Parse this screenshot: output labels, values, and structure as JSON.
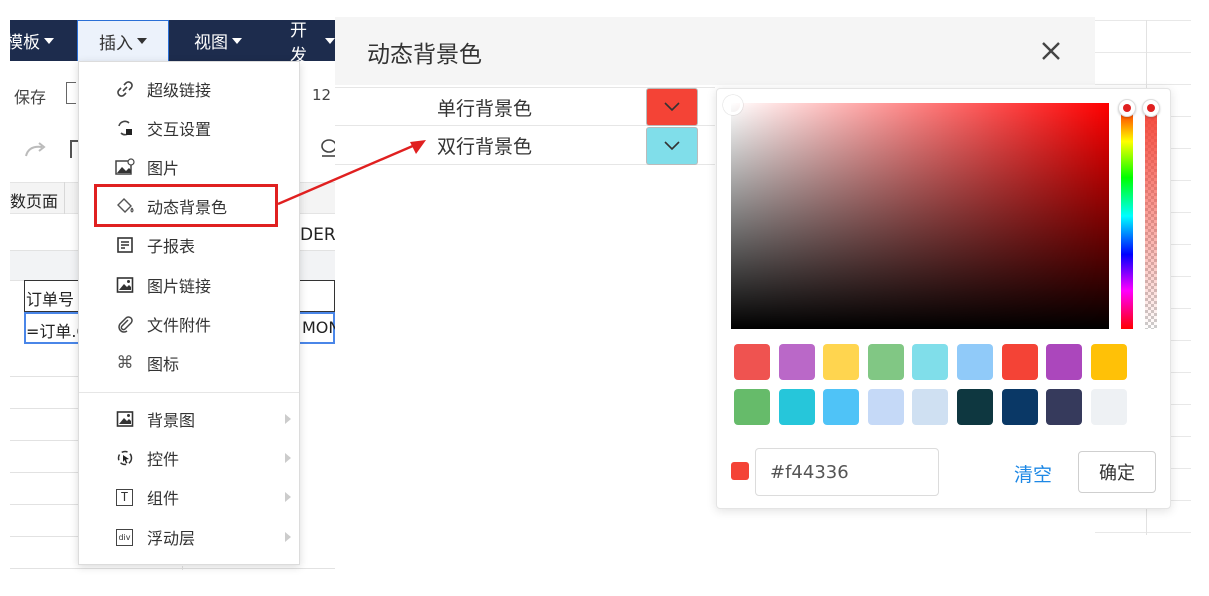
{
  "menubar": {
    "items": [
      {
        "label": "模板"
      },
      {
        "label": "插入"
      },
      {
        "label": "视图"
      },
      {
        "label": "开发"
      }
    ]
  },
  "toolbar": {
    "save_label": "保存",
    "font_size": "12"
  },
  "sheet": {
    "tab_label": "数页面",
    "partial_text_der": "DER",
    "cell_order_no": "订单号",
    "cell_formula": "=订单.C",
    "cell_mon": "MON"
  },
  "insert_menu": {
    "items": [
      {
        "label": "超级链接",
        "icon": "hyperlink-icon"
      },
      {
        "label": "交互设置",
        "icon": "interaction-icon"
      },
      {
        "label": "图片",
        "icon": "image-icon"
      },
      {
        "label": "动态背景色",
        "icon": "paint-bucket-icon"
      },
      {
        "label": "子报表",
        "icon": "subreport-icon"
      },
      {
        "label": "图片链接",
        "icon": "image-link-icon"
      },
      {
        "label": "文件附件",
        "icon": "paperclip-icon"
      },
      {
        "label": "图标",
        "icon": "command-icon"
      },
      {
        "label": "背景图",
        "icon": "background-image-icon",
        "submenu": true
      },
      {
        "label": "控件",
        "icon": "control-icon",
        "submenu": true
      },
      {
        "label": "组件",
        "icon": "text-component-icon",
        "submenu": true
      },
      {
        "label": "浮动层",
        "icon": "div-icon",
        "submenu": true
      }
    ],
    "div_icon_text": "div",
    "t_icon_text": "T"
  },
  "dialog": {
    "title": "动态背景色",
    "rows": [
      {
        "label": "单行背景色",
        "color": "#f44336"
      },
      {
        "label": "双行背景色",
        "color": "#80deea"
      }
    ]
  },
  "color_picker": {
    "hex_value": "#f44336",
    "current_color": "#f44336",
    "clear_label": "清空",
    "confirm_label": "确定",
    "presets": [
      "#ef5350",
      "#ba68c8",
      "#ffd54f",
      "#81c784",
      "#80deea",
      "#90caf9",
      "#f44336",
      "#ab47bc",
      "#ffc107",
      "#66bb6a",
      "#26c6da",
      "#4fc3f7",
      "#c5d9f7",
      "#cfe0f2",
      "#0e3740",
      "#0a3866",
      "#363a5c",
      "#eef1f4"
    ]
  },
  "colors": {
    "menubar_bg": "#1d2c4d",
    "highlight": "#e02020",
    "link": "#1e88e5"
  }
}
